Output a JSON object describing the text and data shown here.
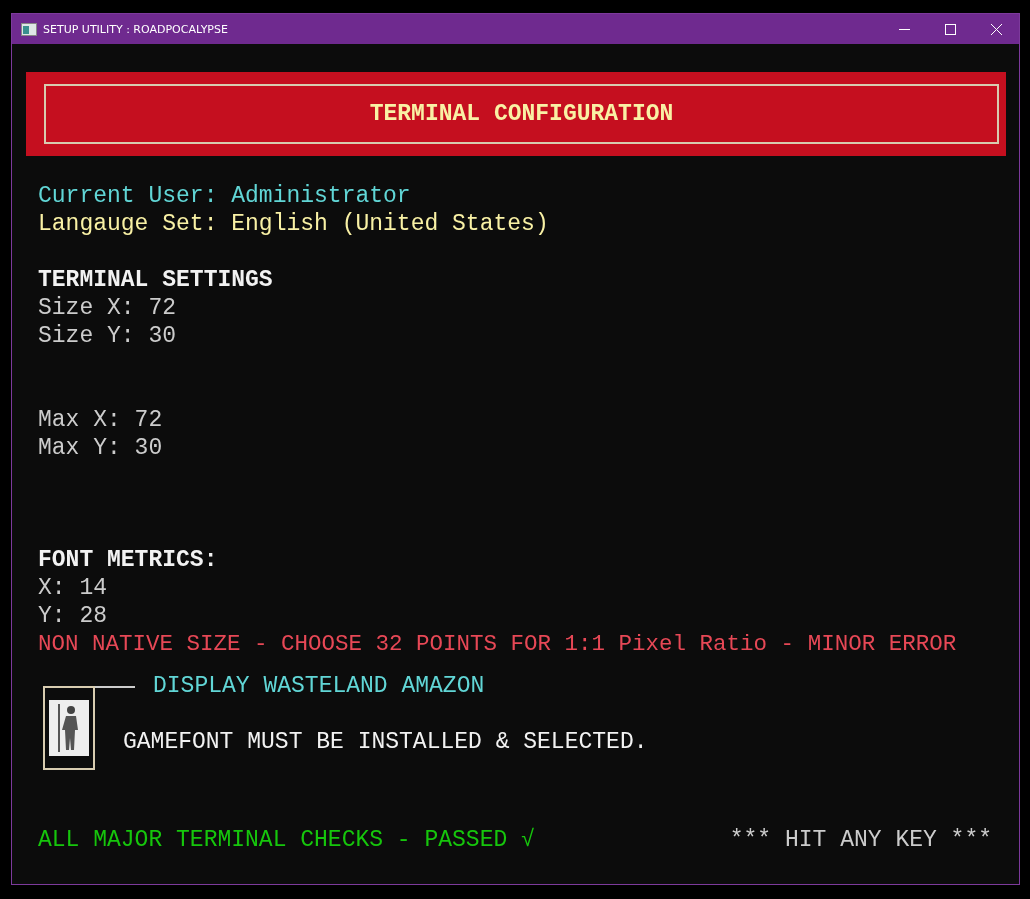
{
  "window": {
    "title": "SETUP UTILITY : ROADPOCALYPSE"
  },
  "banner": {
    "title": "TERMINAL CONFIGURATION"
  },
  "session": [
    {
      "text": "Current User: Administrator",
      "color": "#61d6d6"
    },
    {
      "text": "Langauge Set: English (United States)",
      "color": "#f9f1a5"
    }
  ],
  "terminal_settings": {
    "title": "TERMINAL SETTINGS",
    "lines": [
      "Size X: 72",
      "Size Y: 30"
    ]
  },
  "max": {
    "lines": [
      "Max X: 72",
      "Max Y: 30"
    ]
  },
  "font_metrics": {
    "title": "FONT METRICS:",
    "lines": [
      "X: 14",
      "Y: 28"
    ],
    "warning": "NON NATIVE SIZE - CHOOSE 32 POINTS FOR 1:1 Pixel Ratio - MINOR ERROR"
  },
  "display": {
    "title": "DISPLAY WASTELAND AMAZON",
    "message": "GAMEFONT MUST BE INSTALLED & SELECTED."
  },
  "footer": {
    "status": "ALL MAJOR TERMINAL CHECKS - PASSED √",
    "prompt": "*** HIT ANY KEY ***"
  }
}
